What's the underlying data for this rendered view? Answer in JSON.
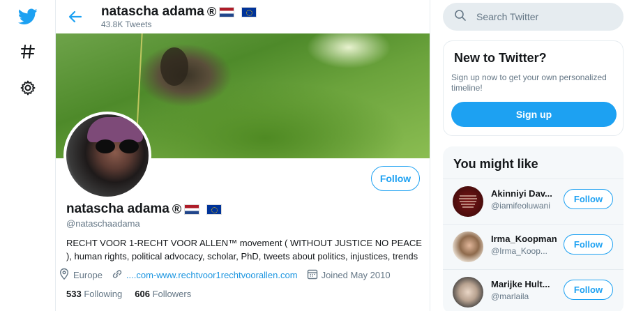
{
  "colors": {
    "accent": "#1da1f2",
    "muted": "#657786",
    "link": "#1b95e0"
  },
  "nav": {
    "icons": [
      "twitter-bird-icon",
      "hashtag-icon",
      "gear-icon"
    ]
  },
  "header": {
    "name": "natascha adama",
    "reg_mark": "®",
    "tweets_count": "43.8K Tweets"
  },
  "profile": {
    "name": "natascha adama",
    "reg_mark": "®",
    "handle": "@nataschaadama",
    "bio": "RECHT VOOR 1-RECHT VOOR ALLEN™ movement ( WITHOUT JUSTICE NO PEACE ), human rights, political advocacy, scholar, PhD, tweets about politics, injustices, trends",
    "location": "Europe",
    "website": "....com-www.rechtvoor1rechtvoorallen.com",
    "joined": "Joined May 2010",
    "following_count": "533",
    "following_label": "Following",
    "followers_count": "606",
    "followers_label": "Followers",
    "follow_label": "Follow"
  },
  "search": {
    "placeholder": "Search Twitter"
  },
  "new_to_twitter": {
    "title": "New to Twitter?",
    "text": "Sign up now to get your own personalized timeline!",
    "signup_label": "Sign up"
  },
  "you_might_like": {
    "title": "You might like",
    "users": [
      {
        "name": "Akinniyi Dav...",
        "handle": "@iamifeoluwani",
        "follow_label": "Follow"
      },
      {
        "name": "Irma_Koopman",
        "handle": "@Irma_Koop...",
        "follow_label": "Follow"
      },
      {
        "name": "Marijke Hult...",
        "handle": "@marlaila",
        "follow_label": "Follow"
      }
    ]
  }
}
